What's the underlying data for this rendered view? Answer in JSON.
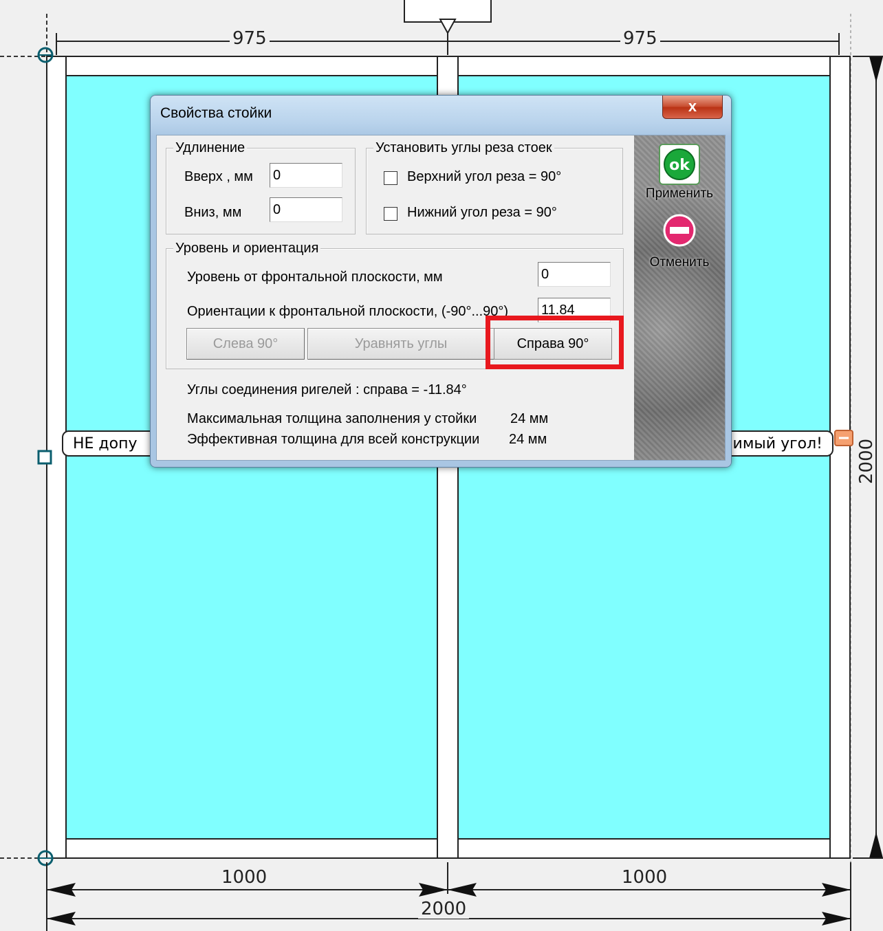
{
  "drawing": {
    "dim_top_left": "975",
    "dim_top_right": "975",
    "dim_bottom_left": "1000",
    "dim_bottom_right": "1000",
    "dim_bottom_total": "2000",
    "dim_right_total": "2000",
    "warning_left_text": "НЕ допу",
    "warning_right_text": "имый угол!",
    "glass_color": "#80ffff"
  },
  "dialog": {
    "title": "Свойства стойки",
    "close_label": "x",
    "extension": {
      "title": "Удлинение",
      "up_label": "Вверх , мм",
      "up_value": "0",
      "down_label": "Вниз, мм",
      "down_value": "0"
    },
    "cut_angles": {
      "title": "Установить углы реза стоек",
      "top_label": "Верхний угол реза = 90°",
      "bottom_label": "Нижний угол реза = 90°",
      "top_checked": false,
      "bottom_checked": false
    },
    "level": {
      "title": "Уровень и ориентация",
      "level_label": "Уровень от фронтальной плоскости, мм",
      "level_value": "0",
      "orient_label": "Ориентации к фронтальной плоскости, (-90°...90°)",
      "orient_value": "11.84",
      "btn_left": "Слева 90°",
      "btn_equalize": "Уравнять углы",
      "btn_right": "Справа 90°"
    },
    "joint_angles": "Углы соединения ригелей :  справа = -11.84°",
    "max_thickness_label": "Максимальная толщина заполнения у стойки",
    "max_thickness_value": "24 мм",
    "eff_thickness_label": "Эффективная толщина для всей конструкции",
    "eff_thickness_value": "24 мм",
    "apply_label": "Применить",
    "apply_icon_text": "ok",
    "cancel_label": "Отменить"
  }
}
